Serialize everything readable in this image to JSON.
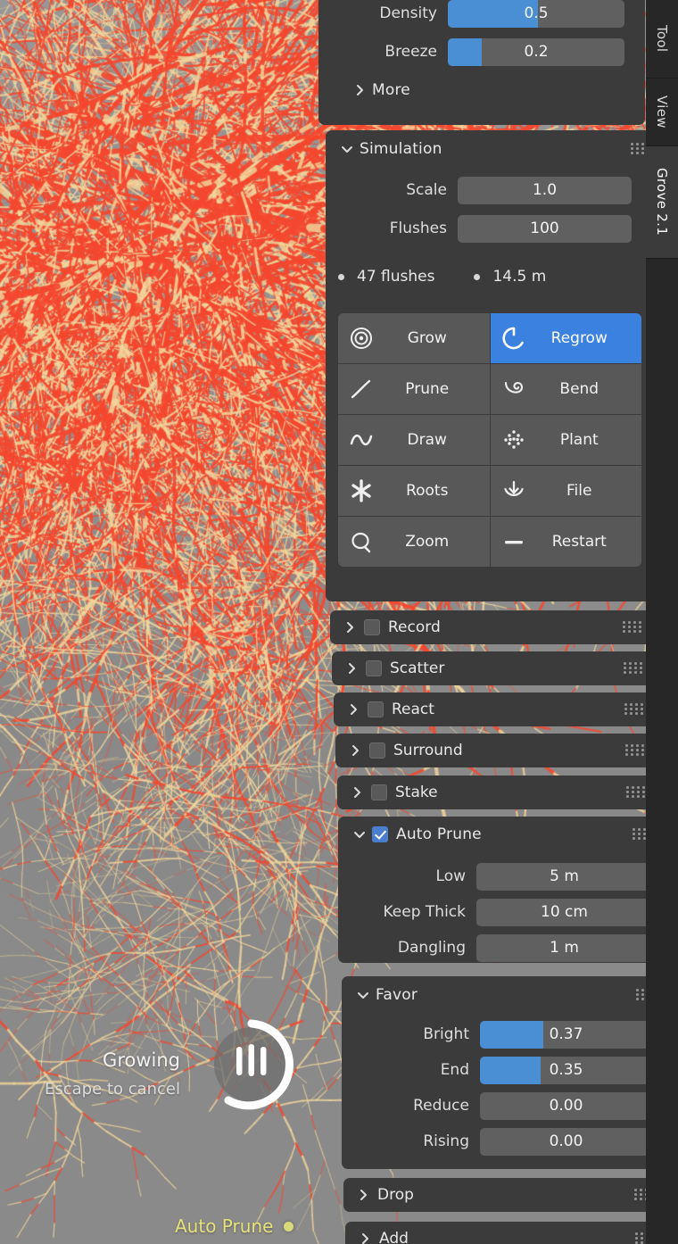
{
  "app": {
    "addon_tab": "Grove 2.1"
  },
  "tabstrip": {
    "tabs": [
      {
        "label": "Tool",
        "active": false
      },
      {
        "label": "View",
        "active": false
      },
      {
        "label": "Grove 2.1",
        "active": true
      }
    ]
  },
  "viewport": {
    "status_title": "Growing",
    "status_hint": "Escape to cancel",
    "bottom_status": "Auto Prune",
    "spinner_icon": "growing-bars-spinner"
  },
  "top_panel": {
    "fields": [
      {
        "label": "Density",
        "value": "0.5",
        "fill_pct": 51,
        "slider": true
      },
      {
        "label": "Breeze",
        "value": "0.2",
        "fill_pct": 19,
        "slider": true
      }
    ],
    "more": {
      "label": "More",
      "expanded": false,
      "chevron": "chevron-right-icon"
    }
  },
  "simulation": {
    "title": "Simulation",
    "expanded": true,
    "chevron": "chevron-down-icon",
    "grip": "drag-grip-icon",
    "fields": [
      {
        "label": "Scale",
        "value": "1.0",
        "slider": false,
        "fill_pct": 0
      },
      {
        "label": "Flushes",
        "value": "100",
        "slider": false,
        "fill_pct": 0
      }
    ],
    "stats": [
      {
        "text": "47 flushes"
      },
      {
        "text": "14.5 m"
      }
    ],
    "buttons": [
      {
        "label": "Grow",
        "icon": "target-rings-icon",
        "selected": false
      },
      {
        "label": "Regrow",
        "icon": "refresh-circle-icon",
        "selected": true
      },
      {
        "label": "Prune",
        "icon": "diagonal-line-icon",
        "selected": false
      },
      {
        "label": "Bend",
        "icon": "spiral-icon",
        "selected": false
      },
      {
        "label": "Draw",
        "icon": "sine-wave-icon",
        "selected": false
      },
      {
        "label": "Plant",
        "icon": "dot-cluster-icon",
        "selected": false
      },
      {
        "label": "Roots",
        "icon": "asterisk-star-icon",
        "selected": false
      },
      {
        "label": "File",
        "icon": "save-tray-icon",
        "selected": false
      },
      {
        "label": "Zoom",
        "icon": "magnifier-icon",
        "selected": false
      },
      {
        "label": "Restart",
        "icon": "dash-line-icon",
        "selected": false
      }
    ]
  },
  "strips": [
    {
      "label": "Record",
      "checked": false,
      "has_checkbox": true,
      "chevron": "chevron-right-icon"
    },
    {
      "label": "Scatter",
      "checked": false,
      "has_checkbox": true,
      "chevron": "chevron-right-icon"
    },
    {
      "label": "React",
      "checked": false,
      "has_checkbox": true,
      "chevron": "chevron-right-icon"
    },
    {
      "label": "Surround",
      "checked": false,
      "has_checkbox": true,
      "chevron": "chevron-right-icon"
    },
    {
      "label": "Stake",
      "checked": false,
      "has_checkbox": true,
      "chevron": "chevron-right-icon"
    }
  ],
  "auto_prune": {
    "title": "Auto Prune",
    "checked": true,
    "expanded": true,
    "chevron": "chevron-down-icon",
    "grip": "drag-grip-icon",
    "fields": [
      {
        "label": "Low",
        "value": "5 m",
        "slider": false,
        "fill_pct": 0
      },
      {
        "label": "Keep Thick",
        "value": "10 cm",
        "slider": false,
        "fill_pct": 0
      },
      {
        "label": "Dangling",
        "value": "1 m",
        "slider": false,
        "fill_pct": 0
      }
    ]
  },
  "favor": {
    "title": "Favor",
    "expanded": true,
    "chevron": "chevron-down-icon",
    "grip": "drag-grip-icon",
    "fields": [
      {
        "label": "Bright",
        "value": "0.37",
        "slider": true,
        "fill_pct": 37
      },
      {
        "label": "End",
        "value": "0.35",
        "slider": true,
        "fill_pct": 35
      },
      {
        "label": "Reduce",
        "value": "0.00",
        "slider": false,
        "fill_pct": 0
      },
      {
        "label": "Rising",
        "value": "0.00",
        "slider": false,
        "fill_pct": 0
      }
    ]
  },
  "bottom_strips": [
    {
      "label": "Drop",
      "has_checkbox": false,
      "chevron": "chevron-right-icon"
    },
    {
      "label": "Add",
      "has_checkbox": false,
      "chevron": "chevron-right-icon"
    }
  ],
  "colors": {
    "panel_bg": "#3b3b3b",
    "field_bg": "#606060",
    "button_bg": "#585858",
    "accent_blue": "#3b82e0",
    "slider_blue": "#4a8fd4",
    "viewport_bg": "#8d8d8d",
    "branch_red": "#f4472f",
    "branch_tan": "#f0d69b",
    "status_yellow": "#e6e27a",
    "tabstrip_bg": "#272727"
  }
}
